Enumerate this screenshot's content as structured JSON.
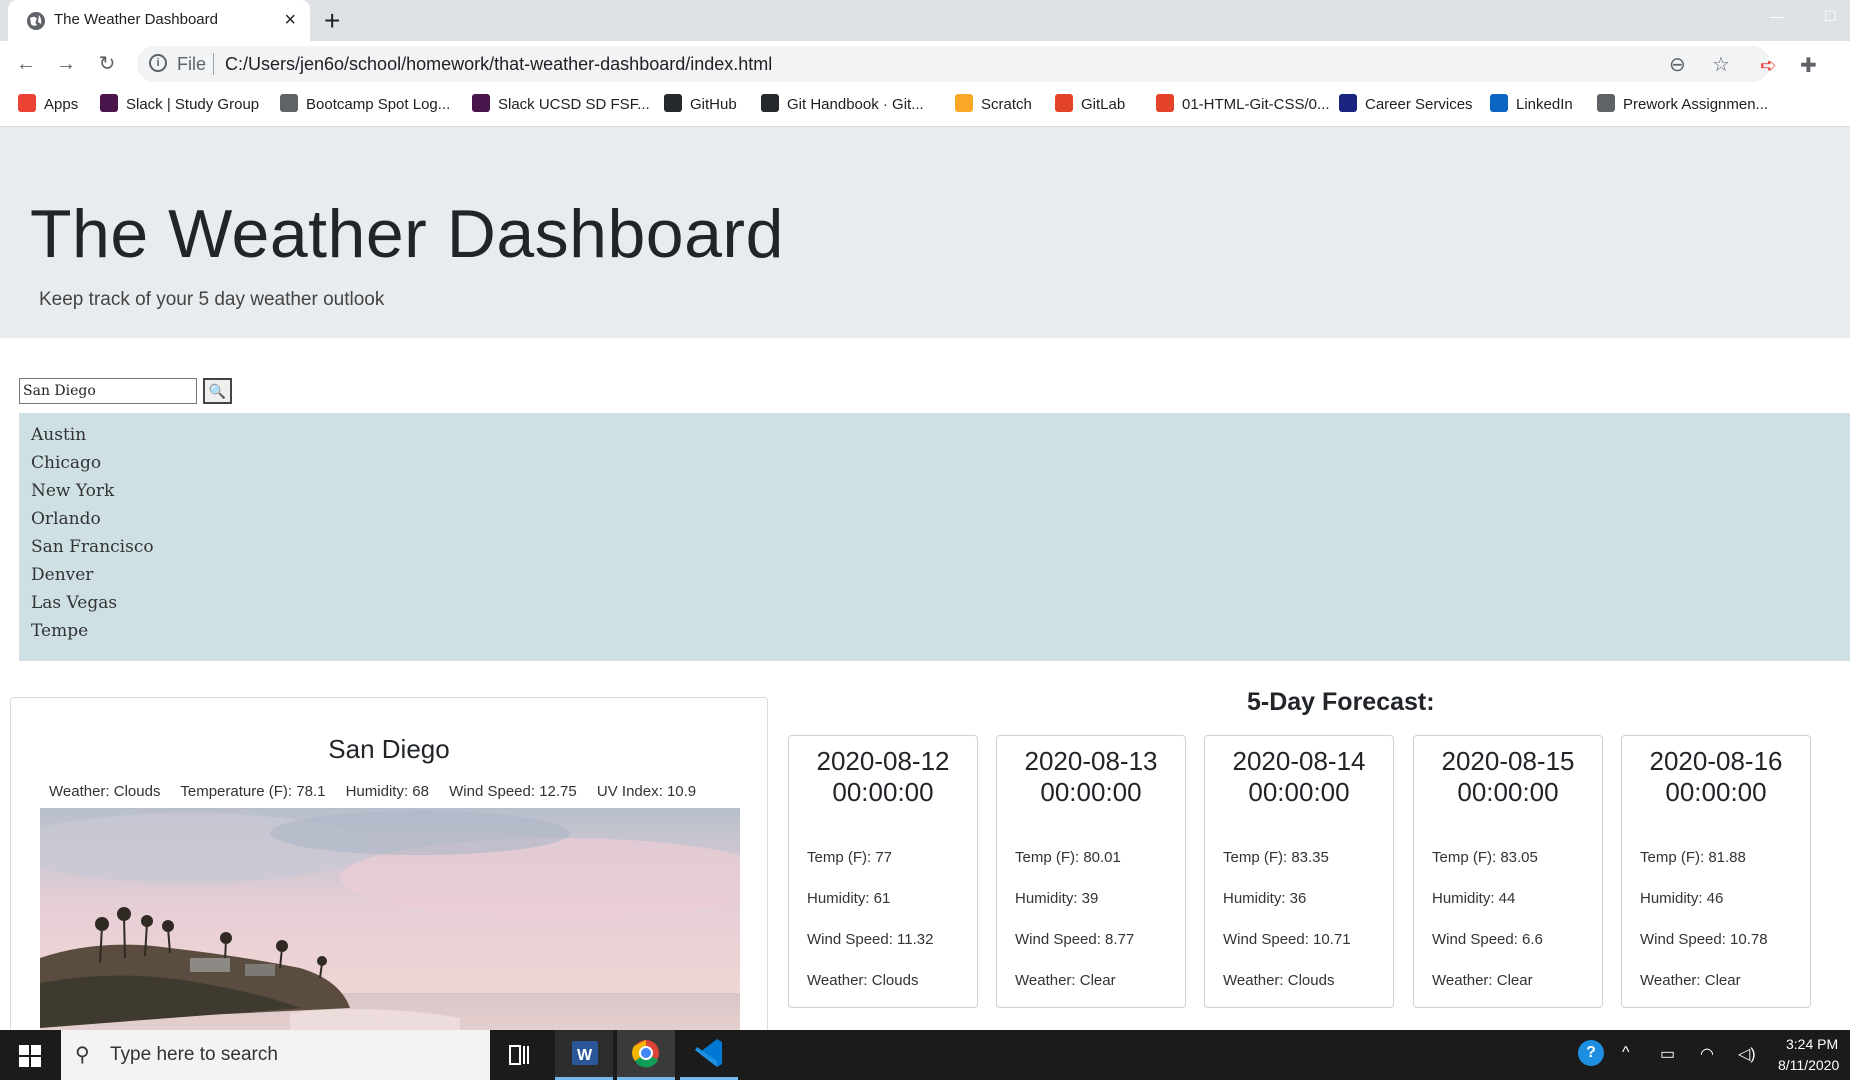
{
  "browser": {
    "tab_title": "The Weather Dashboard",
    "tab_close": "×",
    "new_tab": "+",
    "file_label": "File",
    "url": "C:/Users/jen6o/school/homework/that-weather-dashboard/index.html"
  },
  "bookmarks": [
    {
      "label": "Apps",
      "icon": "apps-grid-icon",
      "color": "#ea4335"
    },
    {
      "label": "Slack | Study Group",
      "icon": "slack-icon",
      "color": "#4a154b"
    },
    {
      "label": "Bootcamp Spot Log...",
      "icon": "globe-icon",
      "color": "#5f6368"
    },
    {
      "label": "Slack UCSD SD FSF...",
      "icon": "slack-icon",
      "color": "#4a154b"
    },
    {
      "label": "GitHub",
      "icon": "github-icon",
      "color": "#24292e"
    },
    {
      "label": "Git Handbook · Git...",
      "icon": "github-icon",
      "color": "#24292e"
    },
    {
      "label": "Scratch",
      "icon": "scratch-icon",
      "color": "#f9a825"
    },
    {
      "label": "GitLab",
      "icon": "gitlab-icon",
      "color": "#e24329"
    },
    {
      "label": "01-HTML-Git-CSS/0...",
      "icon": "gitlab-icon",
      "color": "#e24329"
    },
    {
      "label": "Career Services",
      "icon": "cs-icon",
      "color": "#1a237e"
    },
    {
      "label": "LinkedIn",
      "icon": "linkedin-icon",
      "color": "#0a66c2"
    },
    {
      "label": "Prework Assignmen...",
      "icon": "page-icon",
      "color": "#5f6368"
    }
  ],
  "page": {
    "title": "The Weather Dashboard",
    "lead": "Keep track of your 5 day weather outlook",
    "search_value": "San Diego",
    "search_button": "🔍",
    "cities": [
      "Austin",
      "Chicago",
      "New York",
      "Orlando",
      "San Francisco",
      "Denver",
      "Las Vegas",
      "Tempe"
    ],
    "current": {
      "city": "San Diego",
      "weather": "Weather: Clouds",
      "temp": "Temperature (F): 78.1",
      "humidity": "Humidity: 68",
      "wind": "Wind Speed: 12.75",
      "uv": "UV Index: 10.9"
    },
    "forecast_title": "5-Day Forecast:",
    "forecast": [
      {
        "date": "2020-08-12",
        "time": "00:00:00",
        "temp": "Temp (F): 77",
        "humidity": "Humidity: 61",
        "wind": "Wind Speed: 11.32",
        "weather": "Weather: Clouds"
      },
      {
        "date": "2020-08-13",
        "time": "00:00:00",
        "temp": "Temp (F): 80.01",
        "humidity": "Humidity: 39",
        "wind": "Wind Speed: 8.77",
        "weather": "Weather: Clear"
      },
      {
        "date": "2020-08-14",
        "time": "00:00:00",
        "temp": "Temp (F): 83.35",
        "humidity": "Humidity: 36",
        "wind": "Wind Speed: 10.71",
        "weather": "Weather: Clouds"
      },
      {
        "date": "2020-08-15",
        "time": "00:00:00",
        "temp": "Temp (F): 83.05",
        "humidity": "Humidity: 44",
        "wind": "Wind Speed: 6.6",
        "weather": "Weather: Clear"
      },
      {
        "date": "2020-08-16",
        "time": "00:00:00",
        "temp": "Temp (F): 81.88",
        "humidity": "Humidity: 46",
        "wind": "Wind Speed: 10.78",
        "weather": "Weather: Clear"
      }
    ]
  },
  "taskbar": {
    "search_placeholder": "Type here to search",
    "time": "3:24 PM",
    "date": "8/11/2020"
  }
}
